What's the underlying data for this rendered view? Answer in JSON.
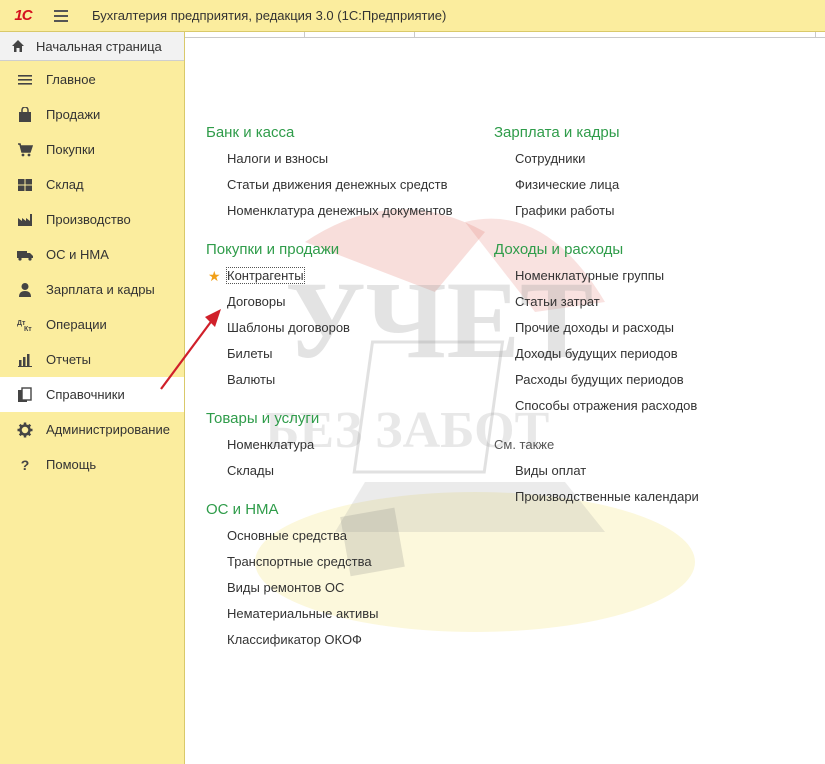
{
  "app": {
    "logo_text": "1С",
    "title": "Бухгалтерия предприятия, редакция 3.0  (1С:Предприятие)"
  },
  "sidebar": {
    "home_label": "Начальная страница",
    "items": [
      {
        "label": "Главное",
        "icon": "list-icon"
      },
      {
        "label": "Продажи",
        "icon": "shopping-bag-icon"
      },
      {
        "label": "Покупки",
        "icon": "cart-icon"
      },
      {
        "label": "Склад",
        "icon": "warehouse-icon"
      },
      {
        "label": "Производство",
        "icon": "factory-icon"
      },
      {
        "label": "ОС и НМА",
        "icon": "truck-icon"
      },
      {
        "label": "Зарплата и кадры",
        "icon": "person-icon"
      },
      {
        "label": "Операции",
        "icon": "dt-kt-icon"
      },
      {
        "label": "Отчеты",
        "icon": "bar-chart-icon"
      },
      {
        "label": "Справочники",
        "icon": "books-icon",
        "active": true
      },
      {
        "label": "Администрирование",
        "icon": "gear-icon"
      },
      {
        "label": "Помощь",
        "icon": "question-icon"
      }
    ]
  },
  "main": {
    "left_column": [
      {
        "title": "Банк и касса",
        "links": [
          "Налоги и взносы",
          "Статьи движения денежных средств",
          "Номенклатура денежных документов"
        ]
      },
      {
        "title": "Покупки и продажи",
        "links": [
          "Контрагенты",
          "Договоры",
          "Шаблоны договоров",
          "Билеты",
          "Валюты"
        ]
      },
      {
        "title": "Товары и услуги",
        "links": [
          "Номенклатура",
          "Склады"
        ]
      },
      {
        "title": "ОС и НМА",
        "links": [
          "Основные средства",
          "Транспортные средства",
          "Виды ремонтов ОС",
          "Нематериальные активы",
          "Классификатор ОКОФ"
        ]
      }
    ],
    "right_column": [
      {
        "title": "Зарплата и кадры",
        "links": [
          "Сотрудники",
          "Физические лица",
          "Графики работы"
        ]
      },
      {
        "title": "Доходы и расходы",
        "links": [
          "Номенклатурные группы",
          "Статьи затрат",
          "Прочие доходы и расходы",
          "Доходы будущих периодов",
          "Расходы будущих периодов",
          "Способы отражения расходов"
        ]
      }
    ],
    "see_also": {
      "label": "См. также",
      "links": [
        "Виды оплат",
        "Производственные календари"
      ]
    }
  },
  "watermark": {
    "line1": "УЧЕТ",
    "line2": "БЕЗ ЗАБОТ"
  },
  "colors": {
    "panel_yellow": "#fbed9e",
    "section_green": "#2f9c4a",
    "star_orange": "#f1a019",
    "arrow_red": "#d0202a"
  }
}
